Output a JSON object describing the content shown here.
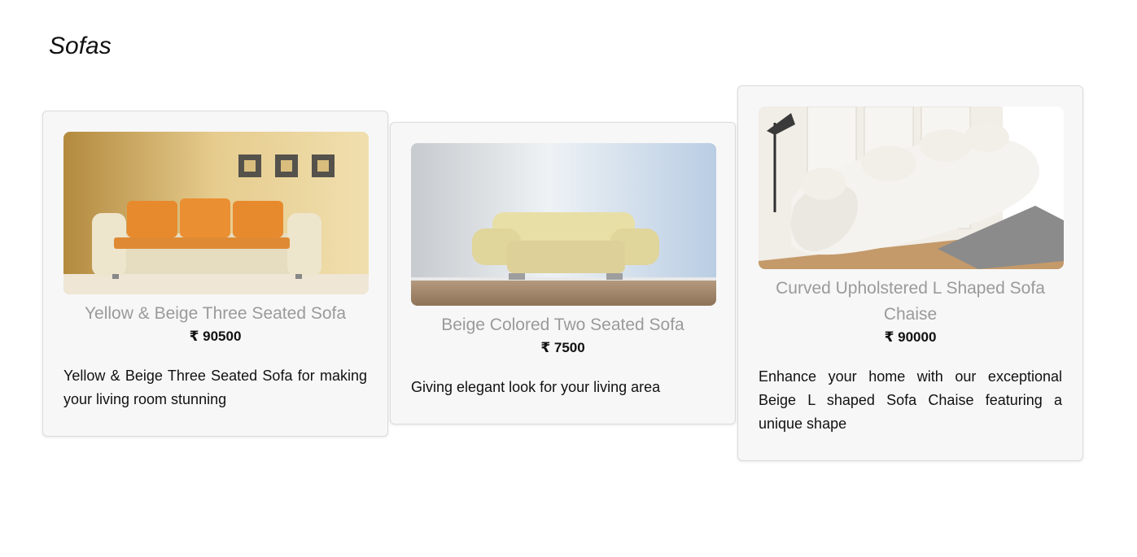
{
  "page": {
    "title": "Sofas"
  },
  "products": [
    {
      "name": "Yellow & Beige Three Seated Sofa",
      "price": "₹ 90500",
      "description": "Yellow & Beige Three Seated Sofa for making your living room stunning",
      "image_icon": "orange-sofa-image"
    },
    {
      "name": "Beige Colored Two Seated Sofa",
      "price": "₹ 7500",
      "description": "Giving elegant look for your living area",
      "image_icon": "beige-sofa-image"
    },
    {
      "name": "Curved Upholstered L Shaped Sofa Chaise",
      "price": "₹ 90000",
      "description": "Enhance your home with our exceptional Beige L shaped Sofa Chaise featuring a unique shape",
      "image_icon": "curved-sofa-image"
    }
  ],
  "colors": {
    "card_background": "#f7f7f7",
    "title_gray": "#9a9a9a",
    "text": "#111111"
  }
}
